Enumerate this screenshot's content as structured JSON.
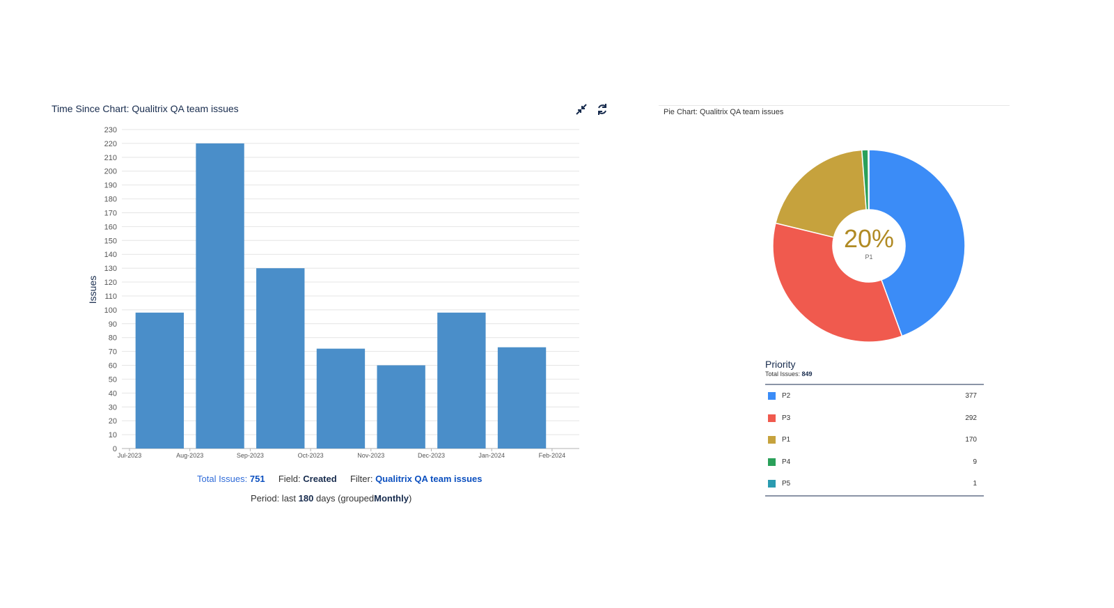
{
  "bar_gadget": {
    "title": "Time Since Chart: Qualitrix QA team issues",
    "footer": {
      "total_label": "Total Issues:",
      "total_value": "751",
      "field_label": "Field:",
      "field_value": "Created",
      "filter_label": "Filter:",
      "filter_value": "Qualitrix QA team issues",
      "period_prefix": "Period: last",
      "period_days": "180",
      "period_mid": "days (grouped",
      "period_group": "Monthly",
      "period_suffix": ")"
    }
  },
  "pie_gadget": {
    "title": "Pie Chart: Qualitrix QA team issues",
    "center_value": "20%",
    "center_label": "P1",
    "legend_title": "Priority",
    "total_label": "Total Issues:",
    "total_value": "849"
  },
  "icons": {
    "collapse": "collapse-icon",
    "refresh": "refresh-icon"
  },
  "colors": {
    "bar": "#4a8ec9",
    "accent": "#0b4fbf"
  },
  "chart_data": [
    {
      "type": "bar",
      "title": "Time Since Chart: Qualitrix QA team issues",
      "ylabel": "Issues",
      "xlabel": "",
      "ylim": [
        0,
        230
      ],
      "ytick_step": 10,
      "grid": true,
      "x_ticks": [
        "Jul-2023",
        "Aug-2023",
        "Sep-2023",
        "Oct-2023",
        "Nov-2023",
        "Dec-2023",
        "Jan-2024",
        "Feb-2024"
      ],
      "bars": [
        {
          "start": 0.1,
          "end": 0.9,
          "value": 98
        },
        {
          "start": 1.1,
          "end": 1.9,
          "value": 220
        },
        {
          "start": 2.1,
          "end": 2.9,
          "value": 130
        },
        {
          "start": 3.1,
          "end": 3.9,
          "value": 72
        },
        {
          "start": 4.1,
          "end": 4.9,
          "value": 60
        },
        {
          "start": 5.1,
          "end": 5.9,
          "value": 98
        },
        {
          "start": 6.1,
          "end": 6.9,
          "value": 73
        }
      ],
      "color": "#4a8ec9"
    },
    {
      "type": "pie",
      "title": "Pie Chart: Qualitrix QA team issues",
      "legend_title": "Priority",
      "total": 849,
      "slices": [
        {
          "label": "P2",
          "value": 377,
          "color": "#3b8cf7"
        },
        {
          "label": "P3",
          "value": 292,
          "color": "#f05a4e"
        },
        {
          "label": "P1",
          "value": 170,
          "color": "#c6a23d"
        },
        {
          "label": "P4",
          "value": 9,
          "color": "#2aa05a"
        },
        {
          "label": "P5",
          "value": 1,
          "color": "#2a9bb0"
        }
      ]
    }
  ]
}
